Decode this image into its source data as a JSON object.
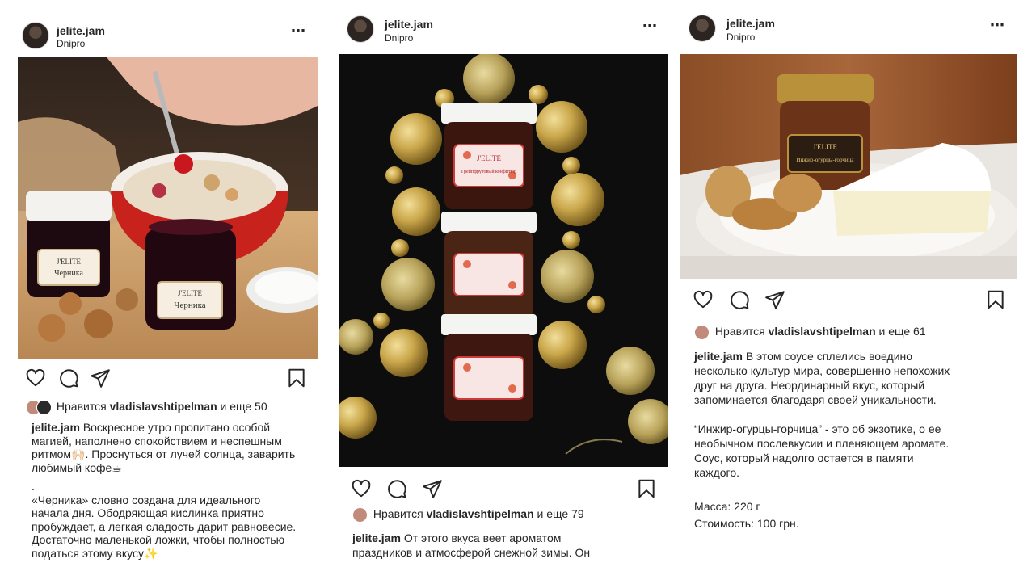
{
  "posts": [
    {
      "username": "jelite.jam",
      "location": "Dnipro",
      "likes": {
        "prefix": "Нравится ",
        "user": "vladislavshtipelman",
        "suffix": " и еще 50"
      },
      "caption_user": "jelite.jam",
      "caption_lines": [
        "Воскресное утро пропитано особой",
        "магией, наполнено спокойствием и неспешным",
        "ритмом🙌🏻. Проснуться от лучей солнца, заварить",
        "любимый кофе☕",
        ".",
        "«Черника» словно создана для идеального",
        "начала дня. Ободряющая кислинка приятно",
        "пробуждает, а легкая сладость дарит равновесие.",
        "Достаточно маленькой ложки, чтобы полностью",
        "податься этому вкусу✨"
      ],
      "photo_labels": [
        "J'ELITE",
        "Черника",
        "J'ELITE",
        "Черника"
      ]
    },
    {
      "username": "jelite.jam",
      "location": "Dnipro",
      "likes": {
        "prefix": "Нравится ",
        "user": "vladislavshtipelman",
        "suffix": " и еще 79"
      },
      "caption_user": "jelite.jam",
      "caption_lines": [
        "От этого вкуса веет ароматом",
        "праздников и атмосферой снежной зимы. Он"
      ],
      "photo_labels": [
        "J'ELITE",
        "Грейпфрутовый конфитюр"
      ]
    },
    {
      "username": "jelite.jam",
      "location": "Dnipro",
      "likes": {
        "prefix": "Нравится ",
        "user": "vladislavshtipelman",
        "suffix": " и еще 61"
      },
      "caption_user": "jelite.jam",
      "caption_lines": [
        "В этом соусе сплелись воедино",
        "несколько культур мира, совершенно непохожих",
        "друг на друга. Неординарный вкус, который",
        "запоминается благодаря  своей уникальности.",
        "",
        "“Инжир-огурцы-горчица” - это об экзотике, о ее",
        "необычном послевкусии и пленяющем аромате.",
        "Соус, который надолго остается в памяти",
        "каждого.",
        "",
        "Масса: 220 г",
        "Стоимость: 100 грн."
      ],
      "photo_labels": [
        "J'ELITE",
        "Инжир-огурцы-горчица"
      ]
    }
  ],
  "icons": {
    "more": "⋯",
    "like": "heart-icon",
    "comment": "comment-icon",
    "share": "paper-plane-icon",
    "save": "bookmark-icon"
  },
  "colors": {
    "text": "#262626",
    "jam_dark": "#2a0b14",
    "jar_lid_gold": "#b8913a",
    "ornament_gold": "#c9a64a"
  }
}
